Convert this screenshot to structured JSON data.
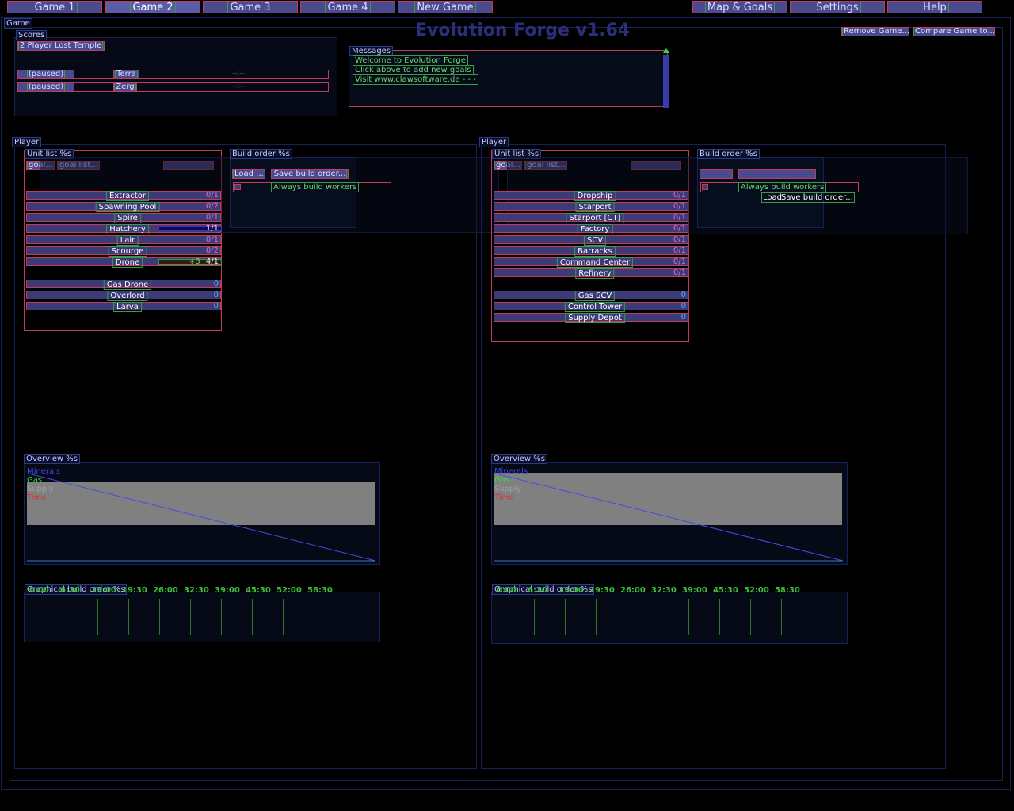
{
  "tabs": [
    "Game 1",
    "Game 2",
    "Game 3",
    "Game 4",
    "New Game"
  ],
  "active_tab": "Game 2",
  "right_tabs": [
    "Map & Goals",
    "Settings",
    "Help"
  ],
  "app_title": "Evolution Forge v1.64",
  "game_label": "Game",
  "game_buttons": {
    "remove": "Remove Game...",
    "compare": "Compare Game to..."
  },
  "scores": {
    "label": "Scores",
    "map_name": "2 Player Lost Temple",
    "rows": [
      {
        "status": "(paused)",
        "race": "Terra",
        "time": "--:--"
      },
      {
        "status": "(paused)",
        "race": "Zerg",
        "time": "--:--"
      }
    ]
  },
  "messages": {
    "label": "Messages",
    "lines": [
      "Welcome to Evolution Forge",
      "Click above to add new goals",
      "Visit www.clawsoftware.de - - -"
    ]
  },
  "players": [
    {
      "label": "Player",
      "unit_list_label": "Unit list %s",
      "goal_btn": "goal...",
      "goal_list_btn": "goal list...",
      "build_order_label": "Build order %s",
      "load_btn": "Load ...",
      "save_btn": "Save build order...",
      "always_build_workers": "Always build workers",
      "units": [
        {
          "name": "Extractor",
          "count": "0/1"
        },
        {
          "name": "Spawning Pool",
          "count": "0/2"
        },
        {
          "name": "Spire",
          "count": "0/1"
        },
        {
          "name": "Hatchery",
          "count": "1/1",
          "bar": 1.0
        },
        {
          "name": "Lair",
          "count": "0/1"
        },
        {
          "name": "Scourge",
          "count": "0/2"
        },
        {
          "name": "Drone",
          "count": "4/1",
          "extra": "+3"
        }
      ],
      "resources": [
        {
          "name": "Gas Drone",
          "count": "0"
        },
        {
          "name": "Overlord",
          "count": "0"
        },
        {
          "name": "Larva",
          "count": "0"
        }
      ],
      "overview_label": "Overview %s",
      "legend": [
        "Minerals",
        "Gas",
        "Supply",
        "Time"
      ],
      "graph_label": "Graphical build order %s",
      "ticks": [
        "0:00",
        "6:30",
        "13:00",
        "19:30",
        "26:00",
        "32:30",
        "39:00",
        "45:30",
        "52:00",
        "58:30"
      ]
    },
    {
      "label": "Player",
      "unit_list_label": "Unit list %s",
      "goal_btn": "goal...",
      "goal_list_btn": "goal list...",
      "build_order_label": "Build order %s",
      "load_btn": "Load",
      "save_btn": "Save build order...",
      "always_build_workers": "Always build workers",
      "units": [
        {
          "name": "Dropship",
          "count": "0/1"
        },
        {
          "name": "Starport",
          "count": "0/1"
        },
        {
          "name": "Starport [CT]",
          "count": "0/1"
        },
        {
          "name": "Factory",
          "count": "0/1"
        },
        {
          "name": "SCV",
          "count": "0/1"
        },
        {
          "name": "Barracks",
          "count": "0/1"
        },
        {
          "name": "Command Center",
          "count": "0/1"
        },
        {
          "name": "Refinery",
          "count": "0/1"
        }
      ],
      "resources": [
        {
          "name": "Gas SCV",
          "count": "0"
        },
        {
          "name": "Control Tower",
          "count": "0"
        },
        {
          "name": "Supply Depot",
          "count": "0"
        }
      ],
      "overview_label": "Overview %s",
      "legend": [
        "Minerals",
        "Gas",
        "Supply",
        "Time"
      ],
      "graph_label": "Graphical build order %s",
      "ticks": [
        "0:00",
        "6:30",
        "13:00",
        "19:30",
        "26:00",
        "32:30",
        "39:00",
        "45:30",
        "52:00",
        "58:30"
      ]
    }
  ],
  "colors": {
    "minerals": "#4848e8",
    "gas": "#30e030",
    "supply": "#a0a0a0",
    "time": "#e03030",
    "button_bg": "#4b4a8f",
    "button_border": "#c03c5a"
  }
}
